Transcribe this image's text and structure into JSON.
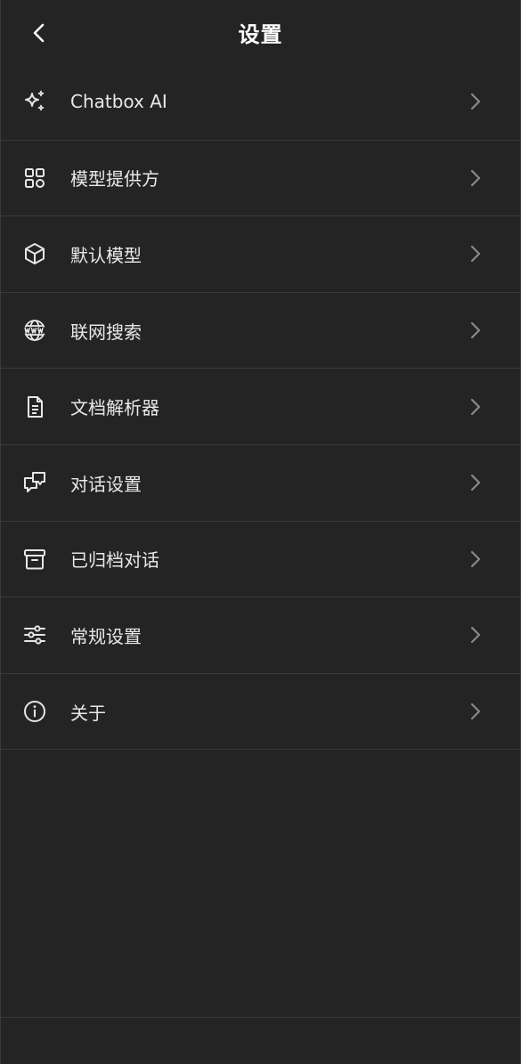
{
  "header": {
    "title": "设置",
    "back_icon": "chevron-left-icon"
  },
  "menu": {
    "items": [
      {
        "key": "chatbox-ai",
        "label": "Chatbox AI",
        "icon": "sparkles-icon"
      },
      {
        "key": "model-provider",
        "label": "模型提供方",
        "icon": "grid-icon"
      },
      {
        "key": "default-model",
        "label": "默认模型",
        "icon": "cube-icon"
      },
      {
        "key": "web-search",
        "label": "联网搜索",
        "icon": "globe-www-icon"
      },
      {
        "key": "doc-parser",
        "label": "文档解析器",
        "icon": "document-icon"
      },
      {
        "key": "chat-settings",
        "label": "对话设置",
        "icon": "chat-bubbles-icon"
      },
      {
        "key": "archived-chats",
        "label": "已归档对话",
        "icon": "archive-icon"
      },
      {
        "key": "general-settings",
        "label": "常规设置",
        "icon": "sliders-icon"
      },
      {
        "key": "about",
        "label": "关于",
        "icon": "info-icon"
      }
    ]
  },
  "colors": {
    "background": "#242424",
    "divider": "#3a3a3a",
    "text": "#e8e8e8",
    "chevron": "#8a8a8a"
  }
}
